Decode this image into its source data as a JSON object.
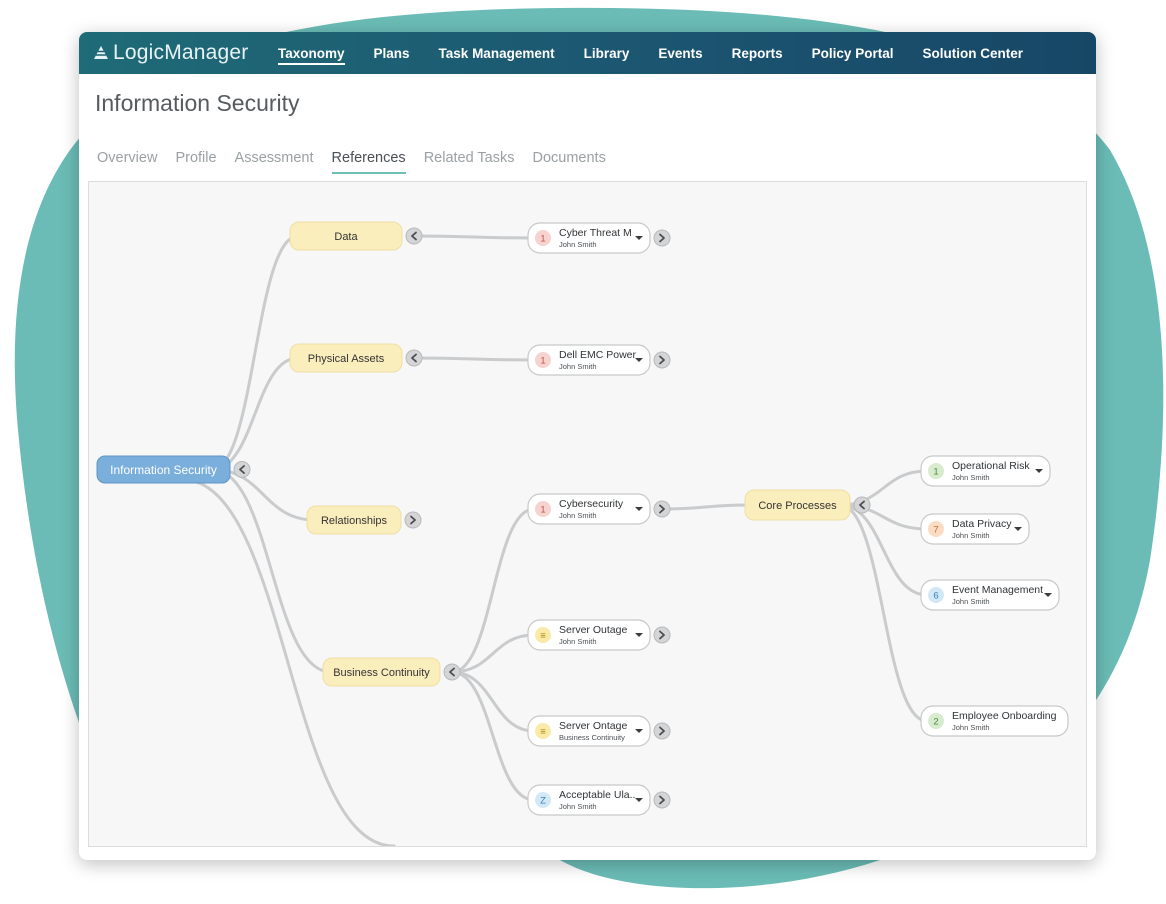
{
  "app": {
    "logo_text": "LogicManager",
    "nav": [
      "Taxonomy",
      "Plans",
      "Task Management",
      "Library",
      "Events",
      "Reports",
      "Policy Portal",
      "Solution Center"
    ],
    "active_nav": 0
  },
  "page": {
    "title": "Information Security",
    "tabs": [
      "Overview",
      "Profile",
      "Assessment",
      "References",
      "Related Tasks",
      "Documents"
    ],
    "active_tab": 3
  },
  "colors": {
    "root_node": "#7aaedb",
    "category_node": "#fbeebd",
    "teal_accent": "#6cc0b6",
    "badge_red": "#f7d3cf",
    "badge_yellow": "#fbe9a8",
    "badge_blue": "#d3e8f7",
    "badge_green": "#d7ecce",
    "badge_orange": "#fbdcc3"
  },
  "mindmap": {
    "root": {
      "label": "Information Security",
      "toggle": "collapse"
    },
    "categories": [
      {
        "id": "data",
        "label": "Data",
        "toggle": "collapse"
      },
      {
        "id": "physical",
        "label": "Physical Assets",
        "toggle": "collapse"
      },
      {
        "id": "relationships",
        "label": "Relationships",
        "toggle": "expand"
      },
      {
        "id": "business",
        "label": "Business Continuity",
        "toggle": "collapse"
      },
      {
        "id": "core",
        "label": "Core Processes",
        "toggle": "collapse"
      }
    ],
    "items": [
      {
        "id": "cyber-threat",
        "parent": "data",
        "badge": "1",
        "badge_color": "red",
        "title": "Cyber Threat M",
        "subtitle": "John Smith",
        "dropdown": true,
        "expand": true
      },
      {
        "id": "dell-emc",
        "parent": "physical",
        "badge": "1",
        "badge_color": "red",
        "title": "Dell EMC Power",
        "subtitle": "John Smith",
        "dropdown": true,
        "expand": true
      },
      {
        "id": "cybersecurity",
        "parent": "business",
        "badge": "1",
        "badge_color": "red",
        "title": "Cybersecurity",
        "subtitle": "John Smith",
        "dropdown": true,
        "expand": true
      },
      {
        "id": "server-outage",
        "parent": "business",
        "badge": "≡",
        "badge_color": "yellow",
        "title": "Server Outage",
        "subtitle": "John Smith",
        "dropdown": true,
        "expand": true
      },
      {
        "id": "server-ontage",
        "parent": "business",
        "badge": "≡",
        "badge_color": "yellow",
        "title": "Server Ontage",
        "subtitle": "Business Continuity",
        "dropdown": true,
        "expand": true
      },
      {
        "id": "acceptable",
        "parent": "business",
        "badge": "Z",
        "badge_color": "blue",
        "title": "Acceptable Ula..",
        "subtitle": "John Smith",
        "dropdown": true,
        "expand": true
      },
      {
        "id": "operational-risk",
        "parent": "core",
        "badge": "1",
        "badge_color": "green",
        "title": "Operational Risk",
        "subtitle": "John Smith",
        "dropdown": true,
        "expand": false
      },
      {
        "id": "data-privacy",
        "parent": "core",
        "badge": "7",
        "badge_color": "orange",
        "title": "Data Privacy",
        "subtitle": "John Smith",
        "dropdown": true,
        "expand": false
      },
      {
        "id": "event-management",
        "parent": "core",
        "badge": "6",
        "badge_color": "blue",
        "title": "Event Management",
        "subtitle": "John Smith",
        "dropdown": true,
        "expand": false
      },
      {
        "id": "employee-onboarding",
        "parent": "core",
        "badge": "2",
        "badge_color": "green",
        "title": "Employee Onboarding",
        "subtitle": "John Smith",
        "dropdown": false,
        "expand": false
      }
    ]
  }
}
